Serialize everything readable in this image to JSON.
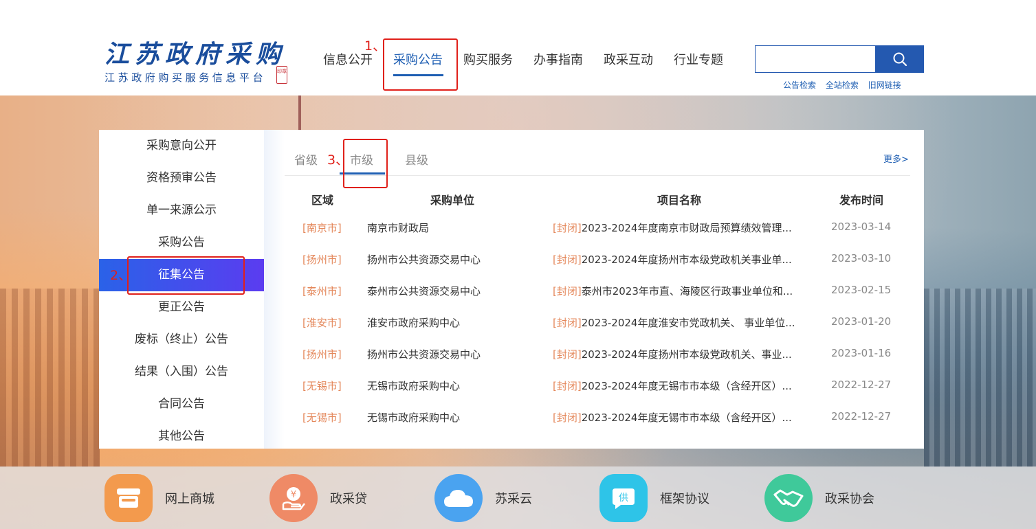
{
  "logo": {
    "title": "江苏政府采购",
    "subtitle": "江苏政府购买服务信息平台",
    "seal": "印章"
  },
  "nav": {
    "items": [
      "信息公开",
      "采购公告",
      "购买服务",
      "办事指南",
      "政采互动",
      "行业专题"
    ],
    "active_index": 1
  },
  "search": {
    "value": "",
    "placeholder": "",
    "quick_links": [
      "公告检索",
      "全站检索",
      "旧网链接"
    ]
  },
  "sidebar": {
    "items": [
      "采购意向公开",
      "资格预审公告",
      "单一来源公示",
      "采购公告",
      "征集公告",
      "更正公告",
      "废标（终止）公告",
      "结果（入围）公告",
      "合同公告",
      "其他公告"
    ],
    "active_index": 4
  },
  "tabs": {
    "items": [
      "省级",
      "市级",
      "县级"
    ],
    "active_index": 1,
    "more": "更多>"
  },
  "table": {
    "headers": [
      "区域",
      "采购单位",
      "项目名称",
      "发布时间"
    ],
    "rows": [
      {
        "region": "[南京市]",
        "unit": "南京市财政局",
        "tag": "[封闭]",
        "project": "2023-2024年度南京市财政局预算绩效管理...",
        "date": "2023-03-14"
      },
      {
        "region": "[扬州市]",
        "unit": "扬州市公共资源交易中心",
        "tag": "[封闭]",
        "project": "2023-2024年度扬州市本级党政机关事业单...",
        "date": "2023-03-10"
      },
      {
        "region": "[泰州市]",
        "unit": "泰州市公共资源交易中心",
        "tag": "[封闭]",
        "project": "泰州市2023年市直、海陵区行政事业单位和...",
        "date": "2023-02-15"
      },
      {
        "region": "[淮安市]",
        "unit": "淮安市政府采购中心",
        "tag": "[封闭]",
        "project": "2023-2024年度淮安市党政机关、 事业单位...",
        "date": "2023-01-20"
      },
      {
        "region": "[扬州市]",
        "unit": "扬州市公共资源交易中心",
        "tag": "[封闭]",
        "project": "2023-2024年度扬州市本级党政机关、事业...",
        "date": "2023-01-16"
      },
      {
        "region": "[无锡市]",
        "unit": "无锡市政府采购中心",
        "tag": "[封闭]",
        "project": "2023-2024年度无锡市市本级（含经开区）...",
        "date": "2022-12-27"
      },
      {
        "region": "[无锡市]",
        "unit": "无锡市政府采购中心",
        "tag": "[封闭]",
        "project": "2023-2024年度无锡市市本级（含经开区）...",
        "date": "2022-12-27"
      }
    ]
  },
  "annotations": [
    "1、",
    "2、",
    "3、"
  ],
  "services": [
    {
      "label": "网上商城",
      "icon": "shop-icon",
      "color": "#f39a4d"
    },
    {
      "label": "政采贷",
      "icon": "loan-icon",
      "color": "#ef8a66"
    },
    {
      "label": "苏采云",
      "icon": "cloud-icon",
      "color": "#4aa3f0"
    },
    {
      "label": "框架协议",
      "icon": "supply-chat-icon",
      "color": "#2ec4e8"
    },
    {
      "label": "政采协会",
      "icon": "handshake-icon",
      "color": "#3fc99a"
    }
  ],
  "service_glyphs": {
    "loan": "¥",
    "supply": "供"
  },
  "colors": {
    "primary": "#1f5fb3",
    "accent_orange": "#e4875a",
    "annotation_red": "#e0201a"
  }
}
